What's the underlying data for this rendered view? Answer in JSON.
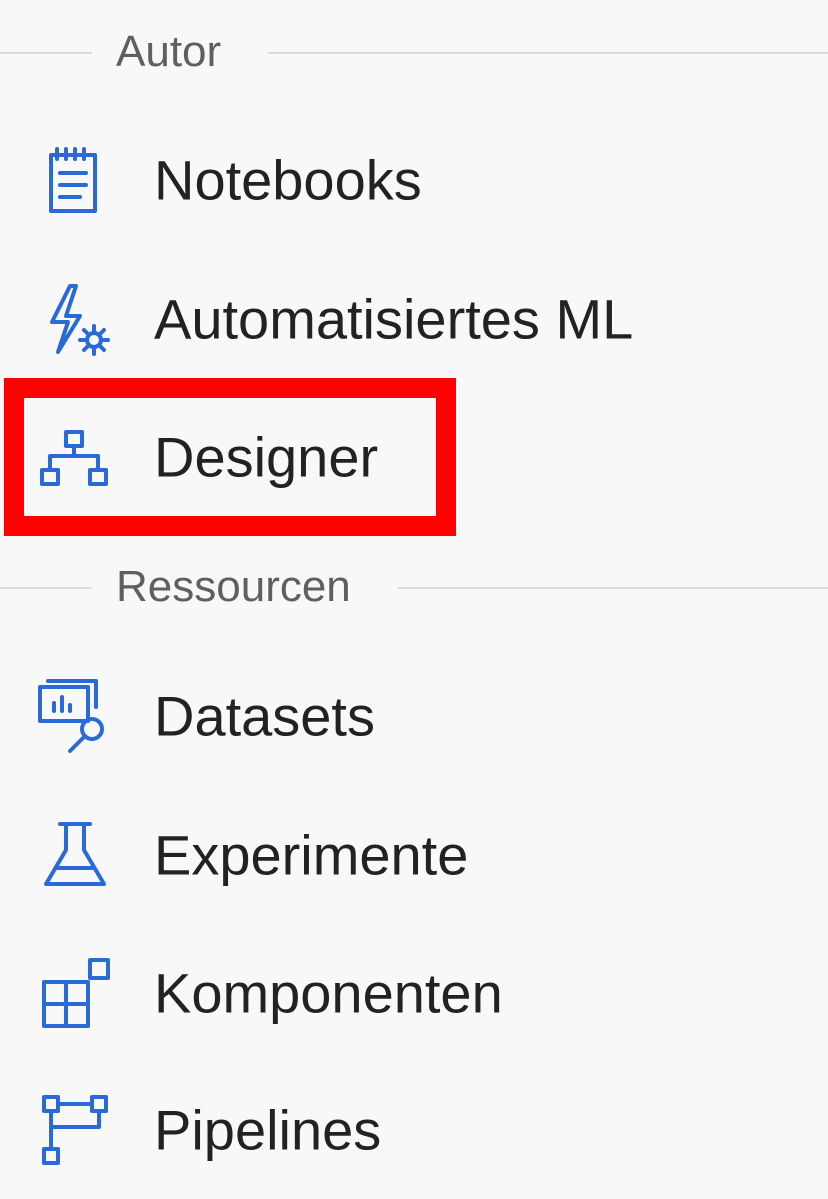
{
  "colors": {
    "icon": "#2a6ad8",
    "highlight": "#ff0000",
    "background": "#f8f8f8"
  },
  "sections": [
    {
      "label": "Autor",
      "items": [
        {
          "label": "Notebooks",
          "icon": "notebook-icon"
        },
        {
          "label": "Automatisiertes ML",
          "icon": "lightning-gear-icon"
        },
        {
          "label": "Designer",
          "icon": "hierarchy-icon",
          "highlighted": true
        }
      ]
    },
    {
      "label": "Ressourcen",
      "items": [
        {
          "label": "Datasets",
          "icon": "dataset-search-icon"
        },
        {
          "label": "Experimente",
          "icon": "flask-icon"
        },
        {
          "label": "Komponenten",
          "icon": "components-icon"
        },
        {
          "label": "Pipelines",
          "icon": "pipeline-icon"
        }
      ]
    }
  ]
}
